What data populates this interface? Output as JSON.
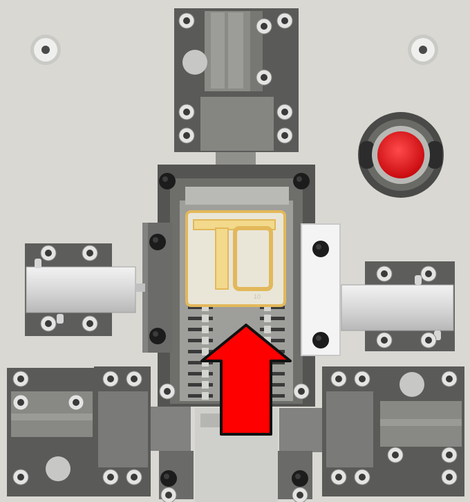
{
  "scene": {
    "colors": {
      "base_plate": "#d9d8d3",
      "dark_block": "#5c5c5a",
      "mid_block": "#7d7d7a",
      "light_block": "#9c9c98",
      "screw_head": "#e6e6e4",
      "screw_socket": "#2e2e2e",
      "rail_silver": "#dcdcdc",
      "white_bar": "#f4f4f4",
      "fixture_yellow": "#e8c46a",
      "button_red": "#e8161a",
      "arrow_red": "#ff0000",
      "arrow_outline": "#111111"
    },
    "icons": {
      "push_direction": "up-arrow-icon",
      "emergency_button": "red-button-icon",
      "fasteners": "hex-socket-screw-icon",
      "dowels": "dowel-pin-icon"
    },
    "fixture_marking": "10"
  }
}
